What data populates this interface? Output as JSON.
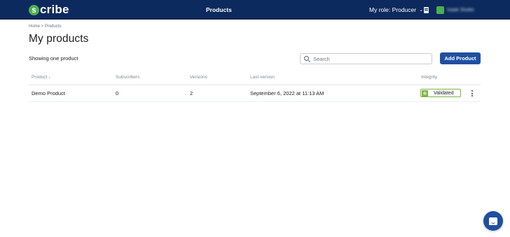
{
  "app": {
    "logo_initial": "s",
    "logo_rest": "cribe",
    "nav_active": "Products",
    "role_label": "My role: Producer",
    "role_chevron": "⌄",
    "user_name": "Isaak Studio"
  },
  "breadcrumb": "Home > Products",
  "page": {
    "title": "My products",
    "showing_text": "Showing one product"
  },
  "search": {
    "placeholder": "Search",
    "value": ""
  },
  "actions": {
    "add_product_label": "Add Product"
  },
  "table": {
    "headers": {
      "product": "Product ↓",
      "subscribers": "Subscribers",
      "versions": "Versions",
      "last_version": "Last version",
      "integrity": "Integrity"
    },
    "rows": [
      {
        "product": "Demo Product",
        "subscribers": "0",
        "versions": "2",
        "last_version": "September 6, 2022 at 11:13 AM",
        "integrity": "Validated"
      }
    ]
  },
  "icons": {
    "search": "search-icon",
    "documents": "document-icon",
    "validated": "check-circle-icon",
    "row_menu": "more-vertical-icon",
    "chat": "chat-icon"
  },
  "colors": {
    "nav_background": "#0d2a5e",
    "primary_button": "#1f4fa0",
    "logo_accent": "#4caf50",
    "validated_border": "#7cb342"
  }
}
